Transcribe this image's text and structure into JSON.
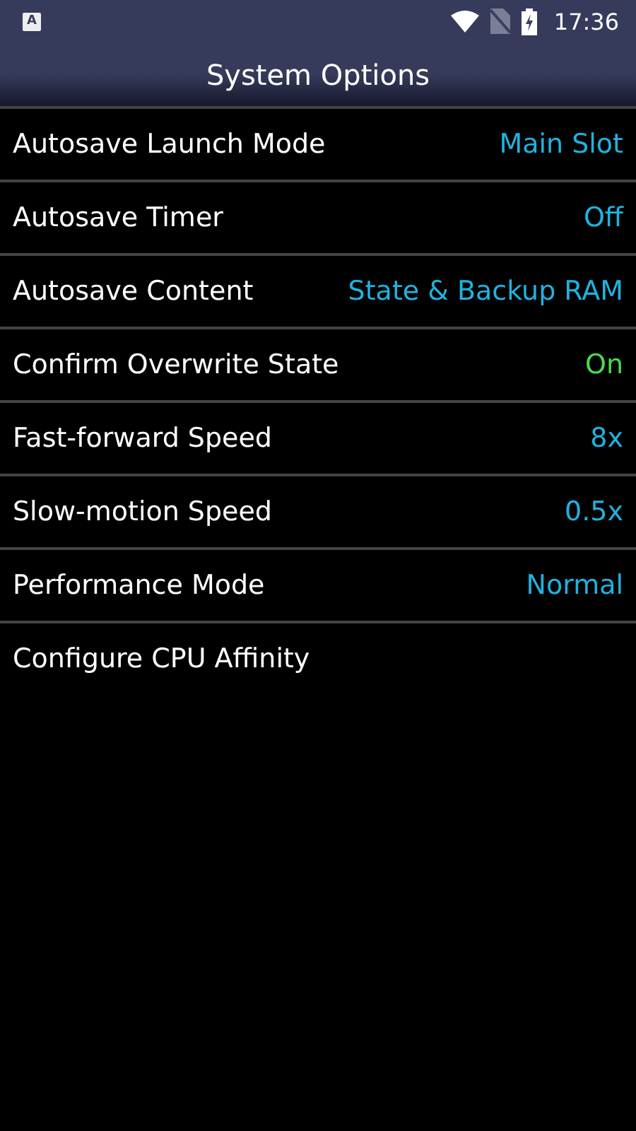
{
  "status_bar": {
    "app_icon": "A",
    "time": "17:36"
  },
  "title": "System Options",
  "options": [
    {
      "kind": "choice",
      "label": "Autosave Launch Mode",
      "value": "Main Slot"
    },
    {
      "kind": "choice",
      "label": "Autosave Timer",
      "value": "Off"
    },
    {
      "kind": "choice",
      "label": "Autosave Content",
      "value": "State & Backup RAM"
    },
    {
      "kind": "toggle",
      "label": "Confirm Overwrite State",
      "value": "On",
      "on": true
    },
    {
      "kind": "choice",
      "label": "Fast-forward Speed",
      "value": "8x"
    },
    {
      "kind": "choice",
      "label": "Slow-motion Speed",
      "value": "0.5x"
    },
    {
      "kind": "choice",
      "label": "Performance Mode",
      "value": "Normal"
    },
    {
      "kind": "action",
      "label": "Configure CPU Affinity"
    }
  ]
}
